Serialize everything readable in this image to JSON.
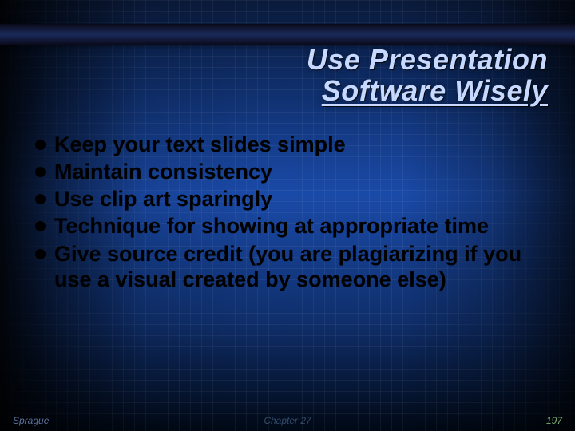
{
  "title": {
    "line1": "Use Presentation",
    "line2": "Software Wisely"
  },
  "bullets": [
    "Keep your text slides simple",
    "Maintain consistency",
    "Use clip art sparingly",
    "Technique for showing at appropriate time",
    "Give source credit (you are plagiarizing if you use a visual created by someone else)"
  ],
  "footer": {
    "left": "Sprague",
    "center": "Chapter 27",
    "right": "197"
  }
}
